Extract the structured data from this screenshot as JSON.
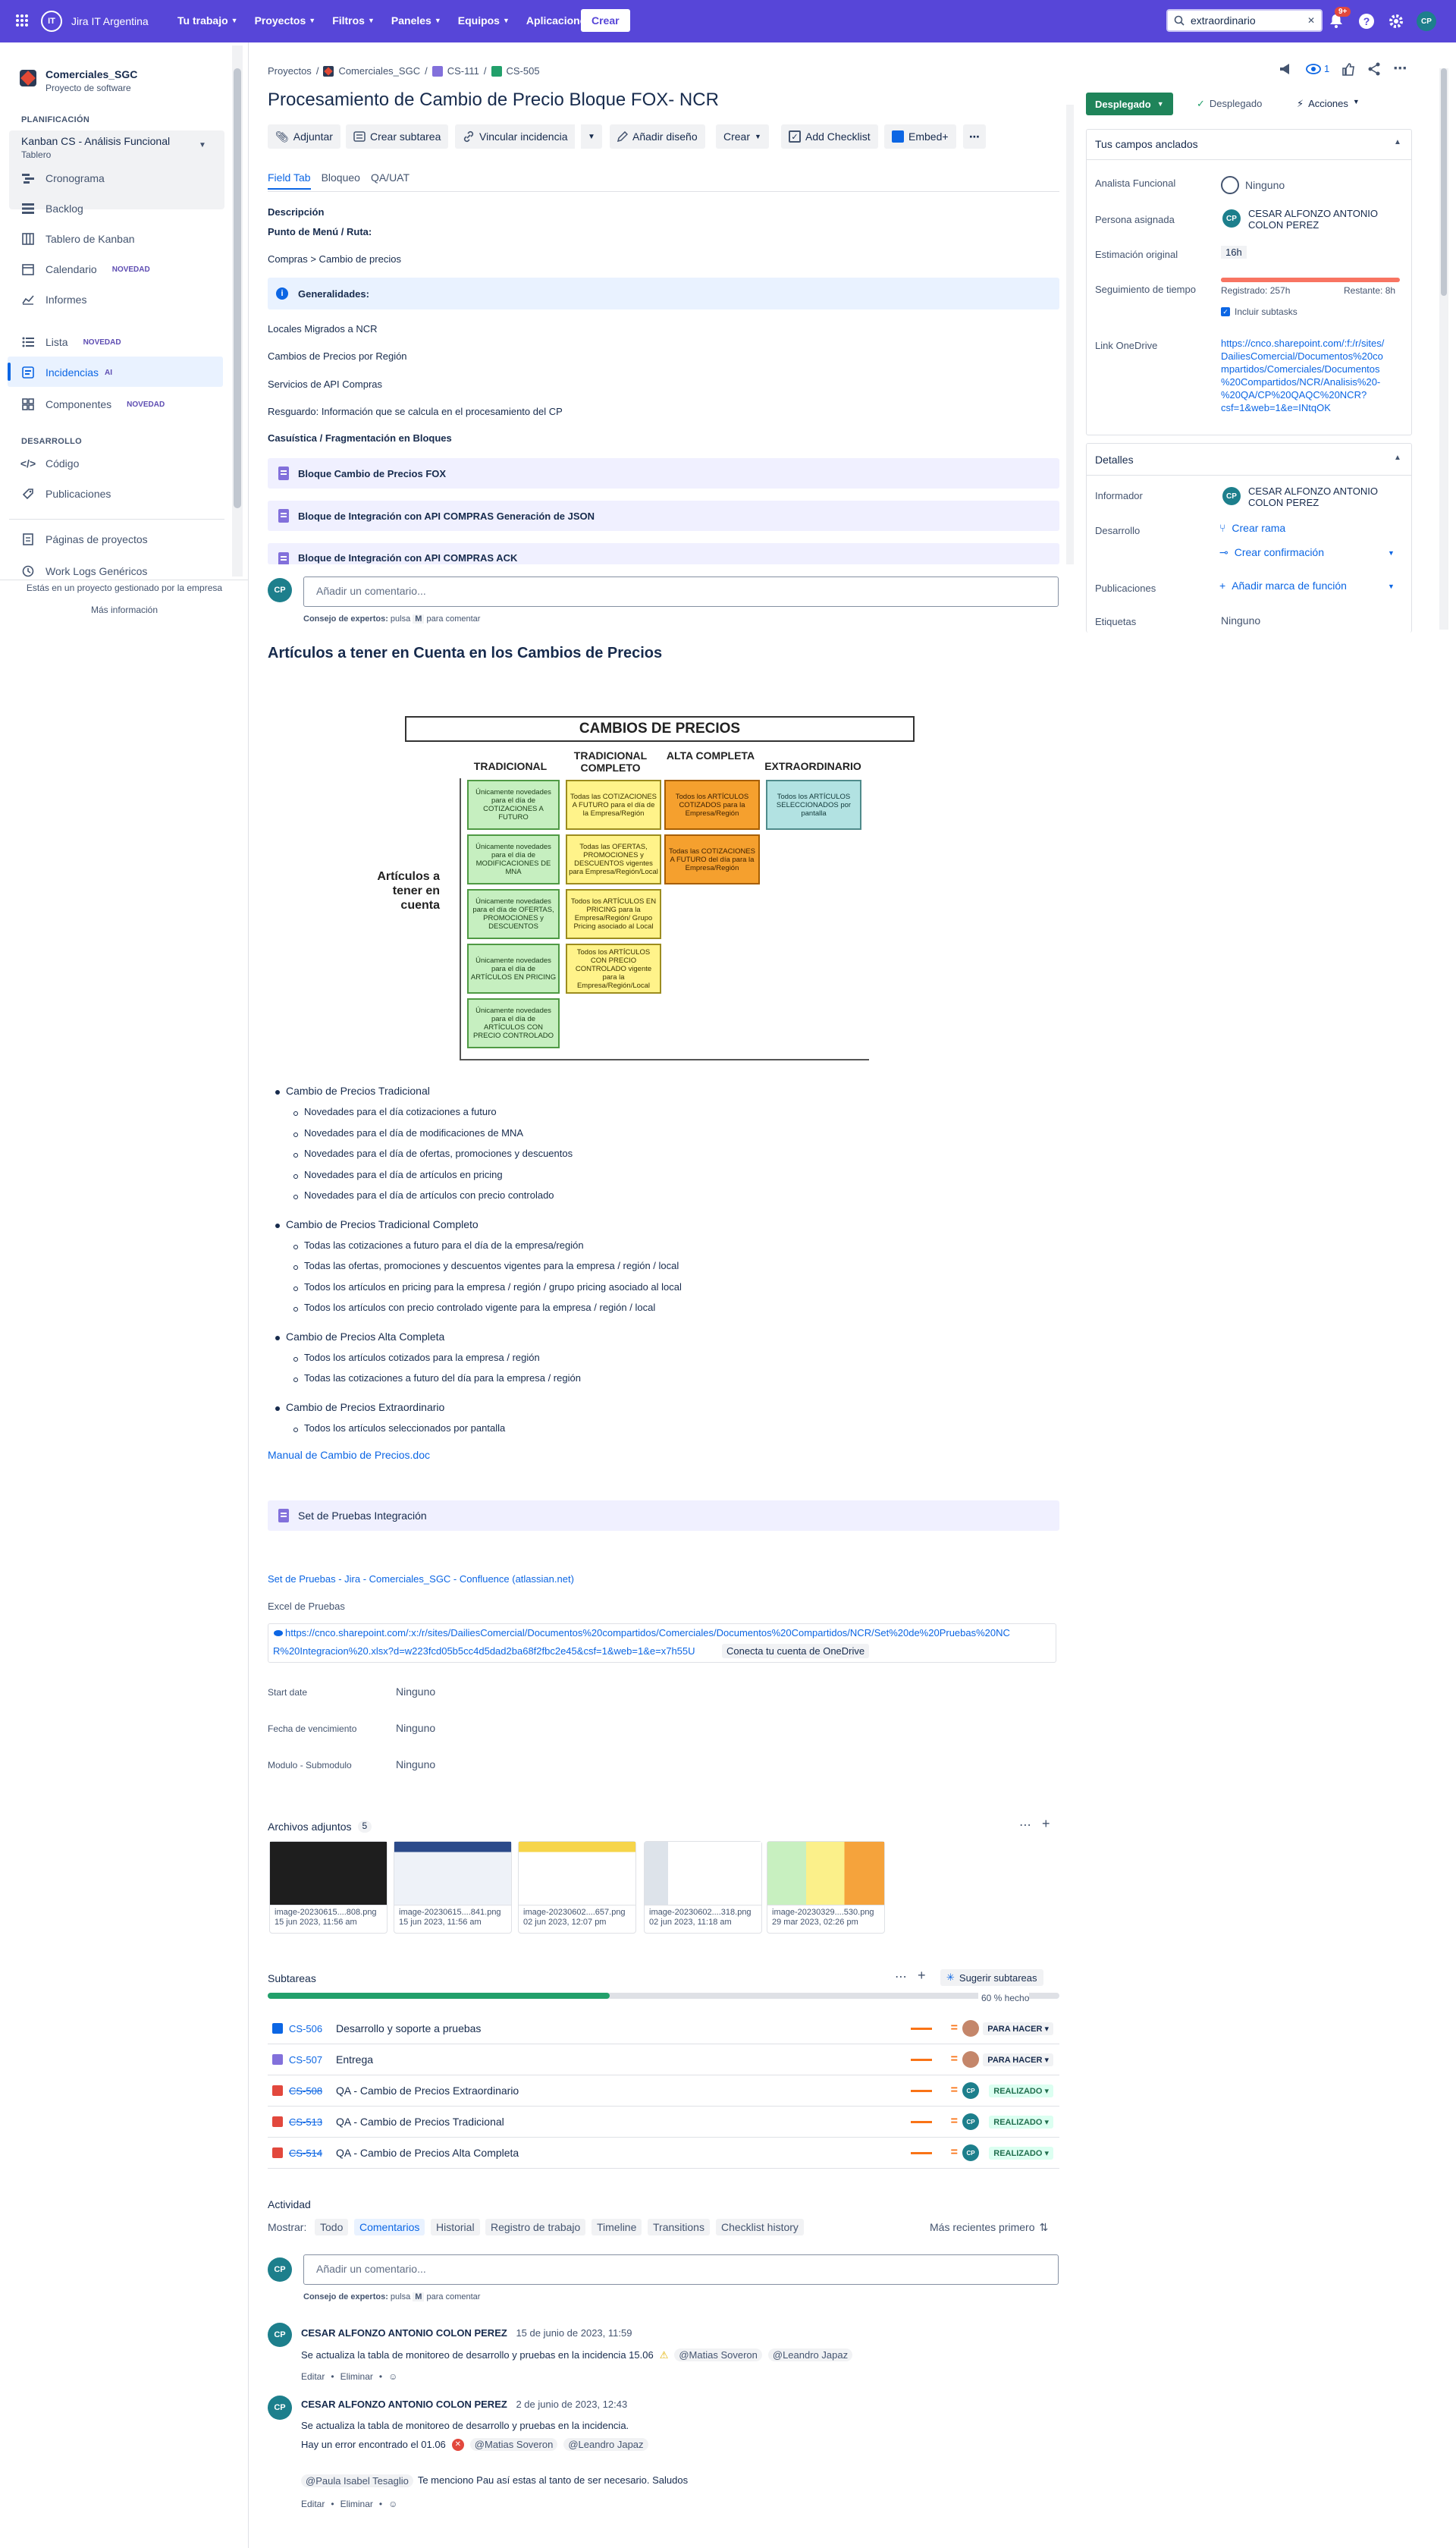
{
  "topnav": {
    "org": "Jira IT Argentina",
    "menus": [
      "Tu trabajo",
      "Proyectos",
      "Filtros",
      "Paneles",
      "Equipos",
      "Aplicaciones"
    ],
    "create": "Crear",
    "search_value": "extraordinario",
    "notifications_count": "9+",
    "user_initials": "CP"
  },
  "sidebar": {
    "project_name": "Comerciales_SGC",
    "project_type": "Proyecto de software",
    "planning_section": "PLANIFICACIÓN",
    "board_name": "Kanban CS - Análisis Funcional",
    "board_type": "Tablero",
    "planning_items": [
      "Cronograma",
      "Backlog",
      "Tablero de Kanban",
      "Calendario",
      "Informes"
    ],
    "calendar_badge": "NOVEDAD",
    "list_label": "Lista",
    "list_badge": "NOVEDAD",
    "issues_label": "Incidencias",
    "issues_ai": "AI",
    "components_label": "Componentes",
    "components_badge": "NOVEDAD",
    "dev_section": "DESARROLLO",
    "dev_items": [
      "Código",
      "Publicaciones"
    ],
    "pages_label": "Páginas de proyectos",
    "worklogs_label": "Work Logs Genéricos",
    "footer_text": "Estás en un proyecto gestionado por la empresa",
    "footer_link": "Más información"
  },
  "breadcrumb": [
    "Proyectos",
    "Comerciales_SGC",
    "CS-111",
    "CS-505"
  ],
  "issue": {
    "title": "Procesamiento de Cambio de Precio Bloque FOX- NCR",
    "watchers": "1",
    "toolbar": [
      "Adjuntar",
      "Crear subtarea",
      "Vincular incidencia",
      "Añadir diseño",
      "Crear",
      "Add Checklist",
      "Embed+"
    ],
    "tabs": [
      "Field Tab",
      "Bloqueo",
      "QA/UAT"
    ],
    "description_label": "Descripción",
    "menu_point_label": "Punto de Menú / Ruta:",
    "menu_path": "Compras > Cambio de precios",
    "generalities": "Generalidades:",
    "gen_lines": [
      "Locales Migrados a NCR",
      "Cambios de Precios por Región",
      "Servicios de API  Compras",
      "Resguardo: Información que se calcula en el procesamiento del CP"
    ],
    "casuistic": "Casuística / Fragmentación en Bloques",
    "blocks": [
      "Bloque Cambio de Precios FOX",
      "Bloque de Integración con API COMPRAS Generación de JSON",
      "Bloque de Integración con API COMPRAS ACK"
    ],
    "comment_placeholder": "Añadir un comentario...",
    "tip_pre": "Consejo de expertos:",
    "tip_mid": "pulsa",
    "tip_key": "M",
    "tip_post": "para comentar"
  },
  "articles": {
    "heading": "Artículos a tener en Cuenta en los Cambios de Precios",
    "image": {
      "title": "CAMBIOS DE PRECIOS",
      "side": "Artículos a tener en cuenta",
      "cols": [
        "TRADICIONAL",
        "TRADICIONAL COMPLETO",
        "ALTA COMPLETA",
        "EXTRAORDINARIO"
      ],
      "col0": [
        "Únicamente novedades para el día de COTIZACIONES A FUTURO",
        "Únicamente novedades para el día de MODIFICACIONES DE MNA",
        "Únicamente novedades para el día de OFERTAS, PROMOCIONES y DESCUENTOS",
        "Únicamente novedades para el día de ARTÍCULOS EN PRICING",
        "Únicamente novedades para el día de ARTÍCULOS CON PRECIO CONTROLADO"
      ],
      "col1": [
        "Todas las COTIZACIONES A FUTURO para el día de la Empresa/Región",
        "Todas las OFERTAS, PROMOCIONES y DESCUENTOS vigentes para Empresa/Región/Local",
        "Todos los ARTÍCULOS EN PRICING para la Empresa/Región/ Grupo Pricing asociado al Local",
        "Todos los ARTÍCULOS CON PRECIO CONTROLADO vigente para la Empresa/Región/Local"
      ],
      "col2": [
        "Todos los ARTÍCULOS COTIZADOS para la Empresa/Región",
        "Todas las COTIZACIONES A FUTURO del día para la Empresa/Región"
      ],
      "col3": [
        "Todos los ARTÍCULOS SELECCIONADOS por pantalla"
      ]
    },
    "groups": [
      {
        "title": "Cambio de Precios Tradicional",
        "items": [
          "Novedades para el día cotizaciones a futuro",
          "Novedades para el día de modificaciones de MNA",
          "Novedades para el día de ofertas, promociones y descuentos",
          "Novedades para el día de artículos en pricing",
          "Novedades para el día de artículos con precio controlado"
        ]
      },
      {
        "title": "Cambio de Precios Tradicional Completo",
        "items": [
          "Todas las cotizaciones a futuro para el día de la empresa/región",
          "Todas las ofertas, promociones y descuentos vigentes para la empresa / región / local",
          "Todos los artículos en pricing para la empresa / región / grupo pricing asociado al local",
          "Todos los artículos con precio controlado vigente para la empresa / región / local"
        ]
      },
      {
        "title": "Cambio de Precios Alta Completa",
        "items": [
          "Todos los artículos cotizados para la empresa / región",
          "Todas las cotizaciones a futuro del día para la empresa / región"
        ]
      },
      {
        "title": "Cambio de Precios Extraordinario",
        "items": [
          "Todos los artículos seleccionados por pantalla"
        ]
      }
    ],
    "manual_link": "Manual de Cambio de Precios.doc",
    "test_set_box": "Set de Pruebas Integración",
    "confluence_link": "Set de Pruebas - Jira - Comerciales_SGC - Confluence (atlassian.net)",
    "excel_label": "Excel de Pruebas",
    "excel_link": "https://cnco.sharepoint.com/:x:/r/sites/DailiesComercial/Documentos%20compartidos/Comerciales/Documentos%20Compartidos/NCR/Set%20de%20Pruebas%20NCR%20Integracion%20.xlsx?d=w223fcd05b5cc4d5dad2ba68f2fbc2e45&csf=1&web=1&e=x7h55U",
    "excel_link_l1": "https://cnco.sharepoint.com/:x:/r/sites/DailiesComercial/Documentos%20compartidos/Comerciales/Documentos%20Compartidos/NCR/Set%20de%20Pruebas%20NC",
    "excel_link_l2": "R%20Integracion%20.xlsx?d=w223fcd05b5cc4d5dad2ba68f2fbc2e45&csf=1&web=1&e=x7h55U",
    "onedrive_btn": "Conecta tu cuenta de OneDrive"
  },
  "fields": [
    {
      "label": "Start date",
      "value": "Ninguno"
    },
    {
      "label": "Fecha de vencimiento",
      "value": "Ninguno"
    },
    {
      "label": "Modulo - Submodulo",
      "value": "Ninguno"
    }
  ],
  "attachments": {
    "label": "Archivos adjuntos",
    "count": "5",
    "files": [
      {
        "name": "image-20230615....808.png",
        "date": "15 jun 2023, 11:56 am"
      },
      {
        "name": "image-20230615....841.png",
        "date": "15 jun 2023, 11:56 am"
      },
      {
        "name": "image-20230602....657.png",
        "date": "02 jun 2023, 12:07 pm"
      },
      {
        "name": "image-20230602....318.png",
        "date": "02 jun 2023, 11:18 am"
      },
      {
        "name": "image-20230329....530.png",
        "date": "29 mar 2023, 02:26 pm"
      }
    ]
  },
  "subtasks": {
    "label": "Subtareas",
    "suggest": "Sugerir subtareas",
    "progress": 0.6,
    "progress_text": "60 % hecho",
    "rows": [
      {
        "key": "CS-506",
        "summary": "Desarrollo y soporte a pruebas",
        "status": "PARA HACER",
        "done": false,
        "type": "task"
      },
      {
        "key": "CS-507",
        "summary": "Entrega",
        "status": "PARA HACER",
        "done": false,
        "type": "sub"
      },
      {
        "key": "CS-508",
        "summary": "QA - Cambio de Precios Extraordinario",
        "status": "REALIZADO",
        "done": true,
        "type": "bug"
      },
      {
        "key": "CS-513",
        "summary": "QA - Cambio de Precios Tradicional",
        "status": "REALIZADO",
        "done": true,
        "type": "bug"
      },
      {
        "key": "CS-514",
        "summary": "QA - Cambio de Precios Alta Completa",
        "status": "REALIZADO",
        "done": true,
        "type": "bug"
      }
    ]
  },
  "activity": {
    "label": "Actividad",
    "show_label": "Mostrar:",
    "tabs": [
      "Todo",
      "Comentarios",
      "Historial",
      "Registro de trabajo",
      "Timeline",
      "Transitions",
      "Checklist history"
    ],
    "active_tab": "Comentarios",
    "sort": "Más recientes primero",
    "comment_placeholder": "Añadir un comentario...",
    "comments": [
      {
        "author": "CESAR ALFONZO ANTONIO COLON PEREZ",
        "date": "15 de junio de 2023, 11:59",
        "text": "Se actualiza la tabla de monitoreo de desarrollo y pruebas en la incidencia 15.06",
        "mentions": [
          "@Matias Soveron",
          "@Leandro Japaz"
        ]
      },
      {
        "author": "CESAR ALFONZO ANTONIO COLON PEREZ",
        "date": "2 de junio de 2023, 12:43",
        "text": "Se actualiza la tabla de monitoreo de desarrollo y pruebas en la incidencia.",
        "text2": "Hay un error encontrado el 01.06",
        "mentions": [
          "@Matias Soveron",
          "@Leandro Japaz"
        ],
        "mention3": "@Paula Isabel Tesaglio",
        "text3": "Te menciono Pau así estas al tanto de ser necesario. Saludos"
      }
    ],
    "edit": "Editar",
    "delete": "Eliminar"
  },
  "right": {
    "status": "Desplegado",
    "status_done": "Desplegado",
    "actions": "Acciones",
    "pinned_header": "Tus campos anclados",
    "analyst_label": "Analista Funcional",
    "analyst_value": "Ninguno",
    "assignee_label": "Persona asignada",
    "assignee_value": "CESAR ALFONZO ANTONIO COLON PEREZ",
    "estimate_label": "Estimación original",
    "estimate_value": "16h",
    "tracking_label": "Seguimiento de tiempo",
    "logged": "Registrado: 257h",
    "remaining": "Restante: 8h",
    "include_subtasks": "Incluir subtasks",
    "onedrive_label": "Link OneDrive",
    "onedrive_link": "https://cnco.sharepoint.com/:f:/r/sites/DailiesComercial/Documentos%20compartidos/Comerciales/Documentos%20Compartidos/NCR/Analisis%20-%20QA/CP%20QAQC%20NCR?csf=1&web=1&e=INtqOK",
    "onedrive_link_lines": [
      "https://cnco.sharepoint.com/:f:/r/sites/",
      "DailiesComercial/Documentos%20co",
      "mpartidos/Comerciales/Documentos",
      "%20Compartidos/NCR/Analisis%20-",
      "%20QA/CP%20QAQC%20NCR?",
      "csf=1&web=1&e=INtqOK"
    ],
    "details_header": "Detalles",
    "reporter_label": "Informador",
    "reporter_value": "CESAR ALFONZO ANTONIO COLON PEREZ",
    "dev_label": "Desarrollo",
    "create_branch": "Crear rama",
    "create_commit": "Crear confirmación",
    "releases_label": "Publicaciones",
    "add_release": "Añadir marca de función",
    "labels_label": "Etiquetas",
    "labels_value": "Ninguno"
  }
}
